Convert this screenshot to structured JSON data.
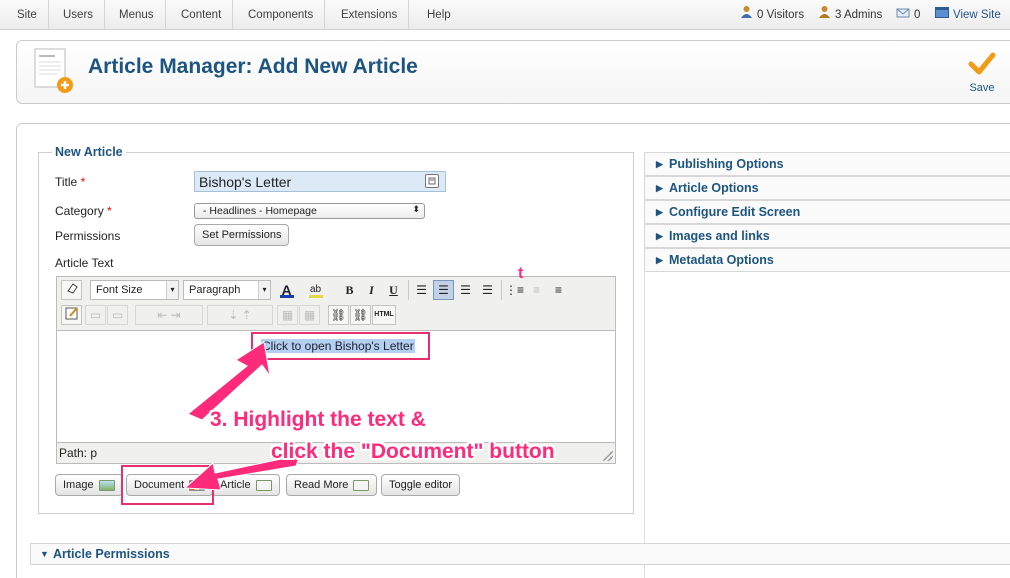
{
  "menu": {
    "items": [
      "Site",
      "Users",
      "Menus",
      "Content",
      "Components",
      "Extensions",
      "Help"
    ]
  },
  "status": {
    "visitors": "0 Visitors",
    "admins": "3 Admins",
    "messages": "0",
    "view_site": "View Site"
  },
  "header": {
    "title": "Article Manager: Add New Article",
    "save_label": "Save"
  },
  "form": {
    "legend": "New Article",
    "title_label": "Title",
    "title_value": "Bishop's Letter",
    "category_label": "Category",
    "category_value": "- Headlines - Homepage",
    "permissions_label": "Permissions",
    "set_permissions_button": "Set Permissions",
    "article_text_label": "Article Text",
    "required_mark": "*"
  },
  "editor": {
    "font_size_select": "Font Size",
    "format_select": "Paragraph",
    "bold": "B",
    "italic": "I",
    "underline": "U",
    "html_button": "HTML",
    "content_text": "Click to open Bishop's Letter",
    "path": "Path: p"
  },
  "editor_buttons": {
    "image": "Image",
    "document": "Document",
    "article": "Article",
    "read_more": "Read More",
    "toggle_editor": "Toggle editor"
  },
  "accordions": [
    "Publishing Options",
    "Article Options",
    "Configure Edit Screen",
    "Images and links",
    "Metadata Options"
  ],
  "permissions_section": "Article Permissions",
  "annotation": {
    "line1": "3. Highlight the text &",
    "line2": "click the \"Document\" button",
    "stray_mark": "t"
  },
  "colors": {
    "heading_blue": "#1d5580",
    "annotation_pink": "#ff2a7a",
    "highlight_box": "#e8306e",
    "title_input_bg": "#dce9f7"
  },
  "icons": [
    "visitors-icon",
    "admins-icon",
    "messages-icon",
    "view-site-icon",
    "article-add-icon",
    "save-checkmark-icon",
    "calendar-icon",
    "image-icon",
    "document-icon",
    "article-link-icon",
    "read-more-icon"
  ]
}
